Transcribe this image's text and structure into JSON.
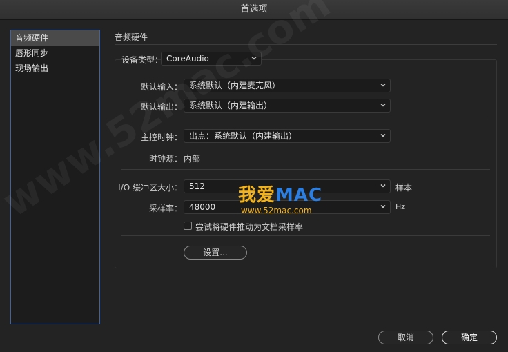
{
  "window": {
    "title": "首选项"
  },
  "sidebar": {
    "items": [
      {
        "label": "音频硬件"
      },
      {
        "label": "唇形同步"
      },
      {
        "label": "现场输出"
      }
    ]
  },
  "section": {
    "title": "音频硬件"
  },
  "device_type": {
    "label": "设备类型：",
    "value": "CoreAudio"
  },
  "default_input": {
    "label": "默认输入：",
    "value": "系统默认（内建麦克风）"
  },
  "default_output": {
    "label": "默认输出：",
    "value": "系统默认（内建输出）"
  },
  "master_clock": {
    "label": "主控时钟：",
    "value": "出点：系统默认（内建输出）"
  },
  "clock_source": {
    "label": "时钟源：",
    "value": "内部"
  },
  "buffer_size": {
    "label": "I/O 缓冲区大小：",
    "value": "512",
    "unit": "样本"
  },
  "sample_rate": {
    "label": "采样率：",
    "value": "48000",
    "unit": "Hz"
  },
  "hardware_pull": {
    "label": "尝试将硬件推动为文档采样率",
    "checked": false
  },
  "settings_button": {
    "label": "设置..."
  },
  "footer": {
    "cancel": "取消",
    "ok": "确定"
  },
  "watermark": {
    "text": "www.52mac.com",
    "logo_cn": "我爱",
    "logo_mac": "MAC",
    "logo_url": "www.52mac.com"
  },
  "colors": {
    "selection_border": "#3d62a6",
    "logo_orange": "#f2b21c",
    "logo_blue": "#2c7fe0"
  }
}
